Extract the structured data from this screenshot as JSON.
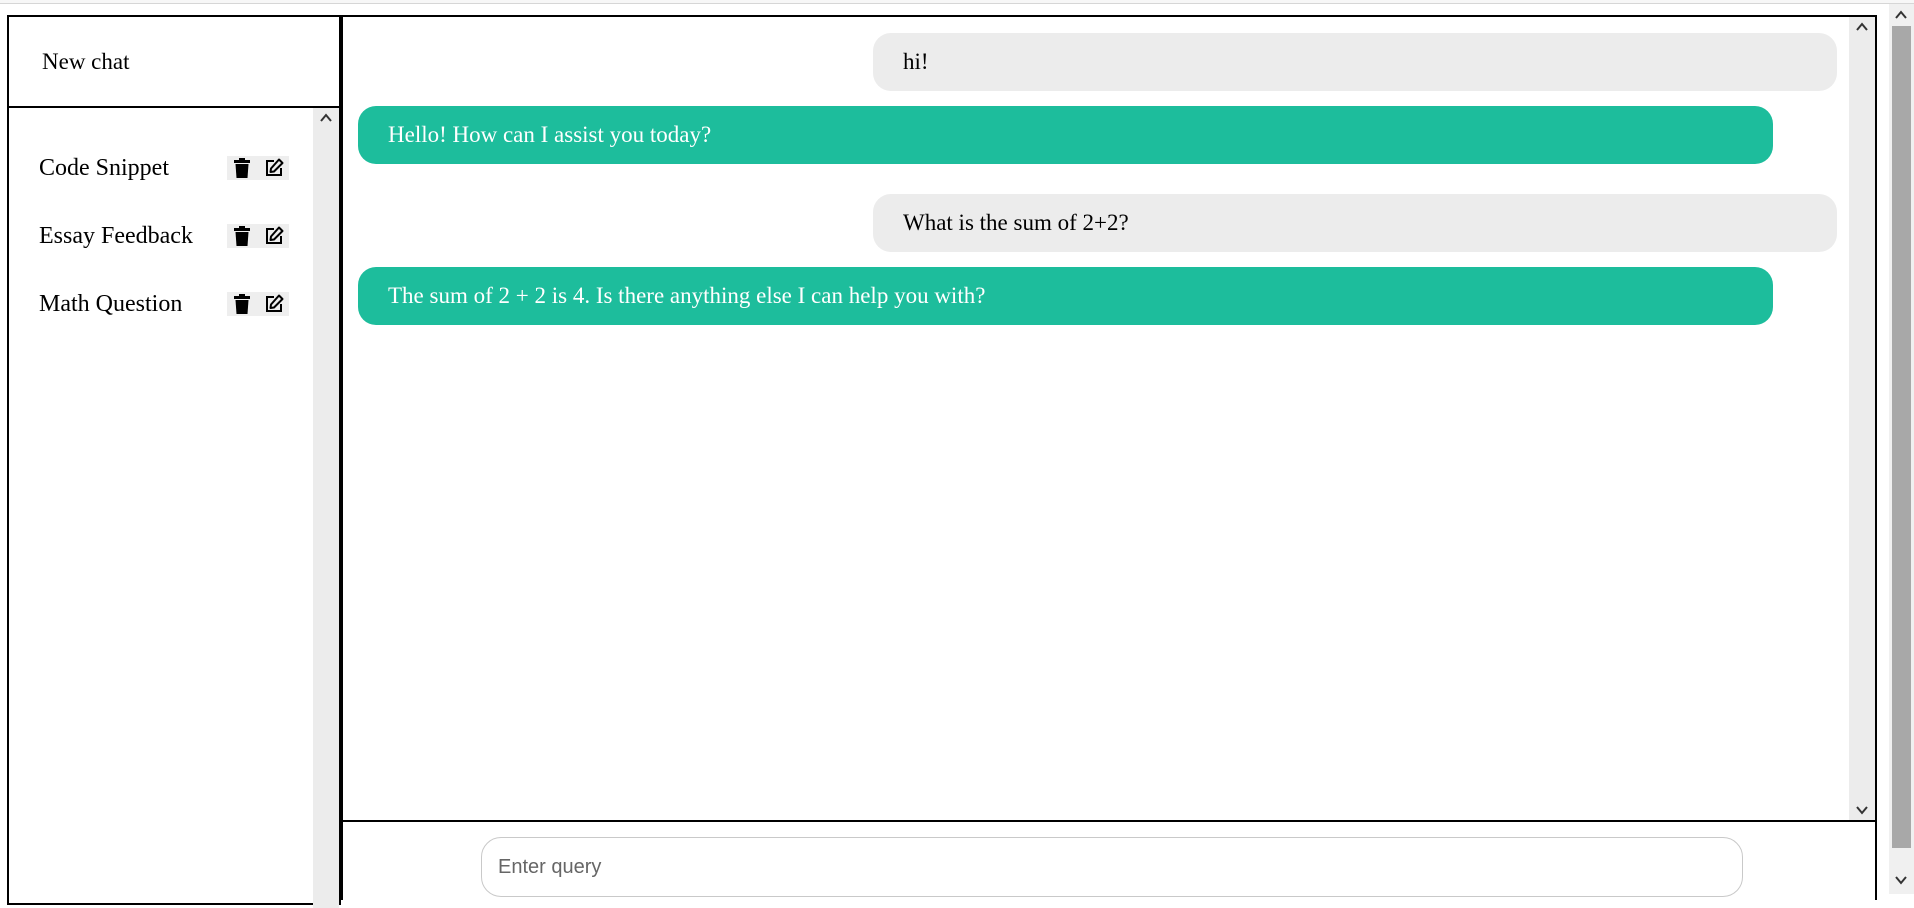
{
  "sidebar": {
    "new_chat_label": "New chat",
    "items": [
      {
        "label": "Code Snippet"
      },
      {
        "label": "Essay Feedback"
      },
      {
        "label": "Math Question"
      }
    ]
  },
  "chat": {
    "messages": [
      {
        "role": "user",
        "text": "hi!"
      },
      {
        "role": "assistant",
        "text": "Hello! How can I assist you today?"
      },
      {
        "role": "user",
        "text": "What is the sum of 2+2?"
      },
      {
        "role": "assistant",
        "text": "The sum of 2 + 2 is 4. Is there anything else I can help you with?"
      }
    ]
  },
  "input": {
    "placeholder": "Enter query",
    "value": ""
  },
  "colors": {
    "assistant_bubble": "#1dbd9c",
    "user_bubble": "#ececec"
  },
  "icons": {
    "delete": "trash-icon",
    "edit": "edit-icon"
  }
}
